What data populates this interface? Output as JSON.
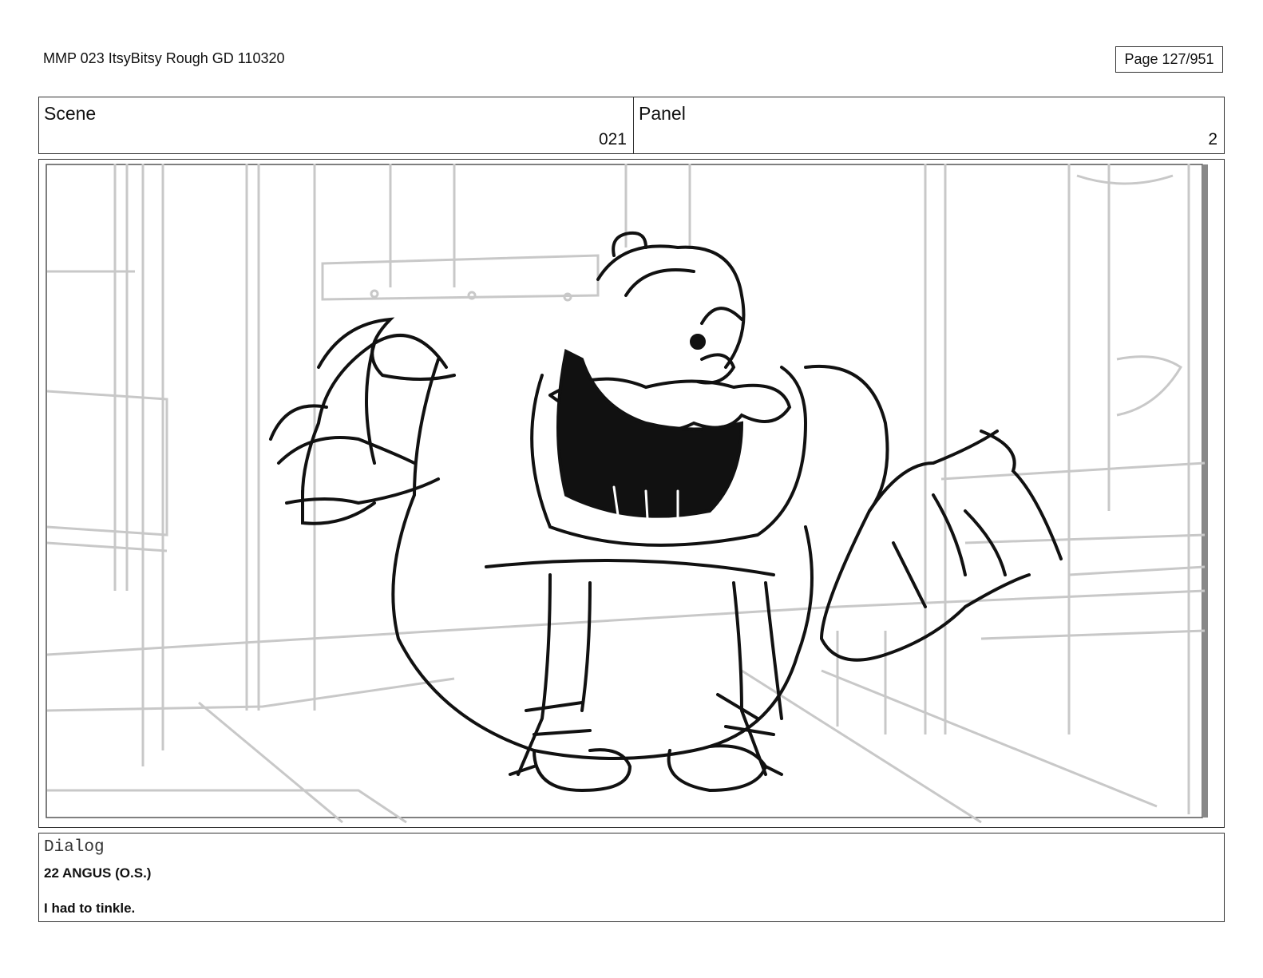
{
  "header": {
    "document_title": "MMP 023 ItsyBitsy Rough GD 110320",
    "page": "Page 127/951"
  },
  "info": {
    "scene_label": "Scene",
    "scene_value": "021",
    "panel_label": "Panel",
    "panel_value": "2"
  },
  "drawing": {
    "description_icon": "storyboard-sketch-icon"
  },
  "dialog": {
    "label": "Dialog",
    "line1": "22 ANGUS (O.S.)",
    "line2": "I had to tinkle."
  },
  "colors": {
    "border": "#333333",
    "background_sketch": "#c8c8c8",
    "foreground_sketch": "#111111"
  }
}
